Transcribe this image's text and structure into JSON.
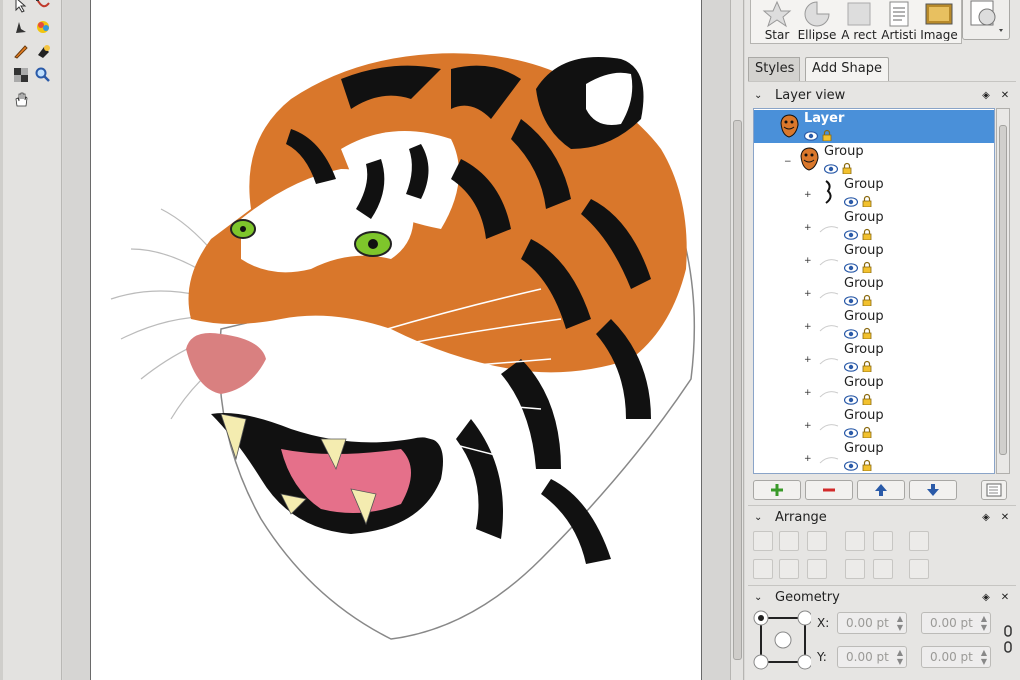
{
  "toolbox": {
    "tools": [
      "select-tool",
      "path-edit-tool",
      "text-tool",
      "color-picker-tool",
      "pencil-tool",
      "fill-tool",
      "pattern-tool",
      "zoom-tool",
      "pan-tool"
    ]
  },
  "canvas": {
    "illustration": "tiger-head"
  },
  "add_shape": {
    "items": [
      {
        "label": "Star",
        "icon": "star-icon"
      },
      {
        "label": "Ellipse",
        "icon": "ellipse-icon"
      },
      {
        "label": "A rect",
        "icon": "rectangle-icon"
      },
      {
        "label": "Artisti",
        "icon": "artistic-text-icon"
      },
      {
        "label": "Image",
        "icon": "image-icon"
      }
    ]
  },
  "tabs": {
    "styles": "Styles",
    "add_shape": "Add Shape"
  },
  "layer_view": {
    "title": "Layer view",
    "rows": [
      {
        "name": "Layer",
        "selected": true
      },
      {
        "name": "Group",
        "selected": false
      },
      {
        "name": "Group"
      },
      {
        "name": "Group"
      },
      {
        "name": "Group"
      },
      {
        "name": "Group"
      },
      {
        "name": "Group"
      },
      {
        "name": "Group"
      },
      {
        "name": "Group"
      },
      {
        "name": "Group"
      },
      {
        "name": "Group"
      }
    ]
  },
  "arrange": {
    "title": "Arrange"
  },
  "geometry": {
    "title": "Geometry",
    "x_label": "X:",
    "y_label": "Y:",
    "x_value": "0.00 pt",
    "x_value2": "0.00 pt",
    "y_value": "0.00 pt",
    "y_value2": "0.00 pt"
  },
  "colors": {
    "selection": "#4a90d9",
    "add": "#3a9a2a",
    "remove": "#d22a2a",
    "arrow": "#2a5aa8"
  }
}
